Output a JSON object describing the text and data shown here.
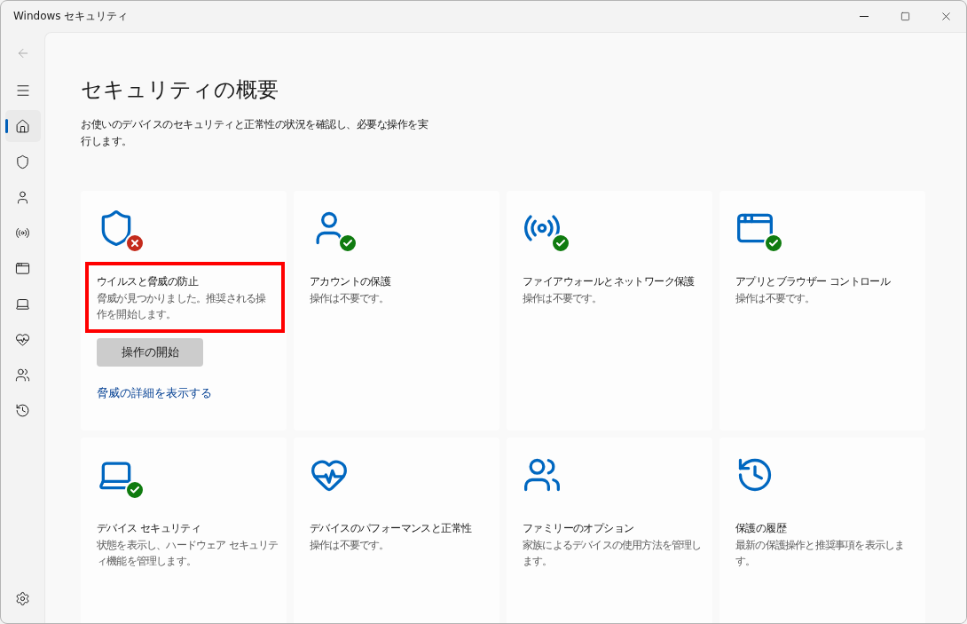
{
  "window": {
    "title": "Windows セキュリティ"
  },
  "sidebar": {
    "back": {
      "disabled": true
    },
    "items": [
      {
        "kind": "home",
        "selected": true
      },
      {
        "kind": "shield",
        "selected": false
      },
      {
        "kind": "person",
        "selected": false
      },
      {
        "kind": "antenna",
        "selected": false
      },
      {
        "kind": "browser",
        "selected": false
      },
      {
        "kind": "laptop",
        "selected": false
      },
      {
        "kind": "heart",
        "selected": false
      },
      {
        "kind": "family",
        "selected": false
      },
      {
        "kind": "history",
        "selected": false
      }
    ]
  },
  "page": {
    "title": "セキュリティの概要",
    "description": "お使いのデバイスのセキュリティと正常性の状況を確認し、必要な操作を実行します。"
  },
  "tiles": [
    {
      "kind": "shield",
      "badge": {
        "kind": "error"
      },
      "highlighted": true,
      "title": "ウイルスと脅威の防止",
      "description": "脅威が見つかりました。推奨される操作を開始します。",
      "button": "操作の開始",
      "link": "脅威の詳細を表示する"
    },
    {
      "kind": "person",
      "badge": {
        "kind": "check"
      },
      "highlighted": false,
      "title": "アカウントの保護",
      "description": "操作は不要です。"
    },
    {
      "kind": "antenna",
      "badge": {
        "kind": "check"
      },
      "highlighted": false,
      "title": "ファイアウォールとネットワーク保護",
      "description": "操作は不要です。"
    },
    {
      "kind": "browser",
      "badge": {
        "kind": "check"
      },
      "highlighted": false,
      "title": "アプリとブラウザー コントロール",
      "description": "操作は不要です。"
    },
    {
      "kind": "laptop",
      "badge": {
        "kind": "check"
      },
      "highlighted": false,
      "title": "デバイス セキュリティ",
      "description": "状態を表示し、ハードウェア セキュリティ機能を管理します。"
    },
    {
      "kind": "heart",
      "highlighted": false,
      "title": "デバイスのパフォーマンスと正常性",
      "description": "操作は不要です。"
    },
    {
      "kind": "family",
      "highlighted": false,
      "title": "ファミリーのオプション",
      "description": "家族によるデバイスの使用方法を管理します。"
    },
    {
      "kind": "history",
      "highlighted": false,
      "title": "保護の履歴",
      "description": "最新の保護操作と推奨事項を表示します。"
    }
  ]
}
